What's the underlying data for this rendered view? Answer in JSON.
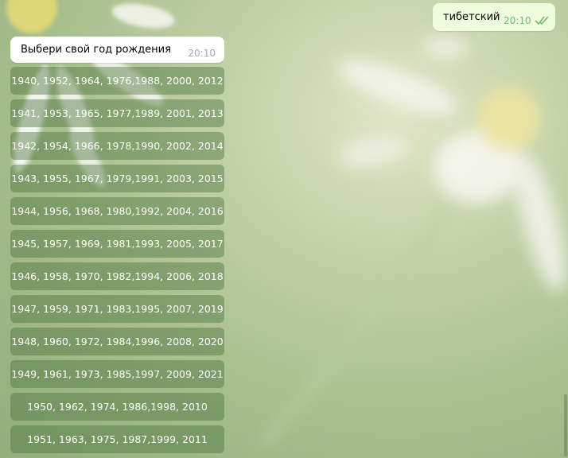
{
  "outgoing_message": {
    "text": "тибетский",
    "time": "20:10",
    "status_icon": "double-check-icon"
  },
  "incoming_message": {
    "text": "Выбери свой год рождения",
    "time": "20:10"
  },
  "keyboard_buttons": [
    "1940, 1952, 1964, 1976,1988, 2000, 2012",
    "1941, 1953, 1965, 1977,1989, 2001, 2013",
    "1942, 1954, 1966, 1978,1990, 2002, 2014",
    "1943, 1955, 1967, 1979,1991, 2003, 2015",
    "1944, 1956, 1968, 1980,1992, 2004, 2016",
    "1945, 1957, 1969, 1981,1993, 2005, 2017",
    "1946, 1958, 1970, 1982,1994, 2006, 2018",
    "1947, 1959, 1971, 1983,1995, 2007, 2019",
    "1948, 1960, 1972, 1984,1996, 2008, 2020",
    "1949, 1961, 1973, 1985,1997, 2009, 2021",
    "1950, 1962, 1974, 1986,1998, 2010",
    "1951, 1963, 1975, 1987,1999, 2011"
  ],
  "colors": {
    "outgoing_bubble": "#effdde",
    "incoming_bubble": "#ffffff",
    "outgoing_time": "#6ebd72",
    "incoming_time": "#a0acb6"
  }
}
